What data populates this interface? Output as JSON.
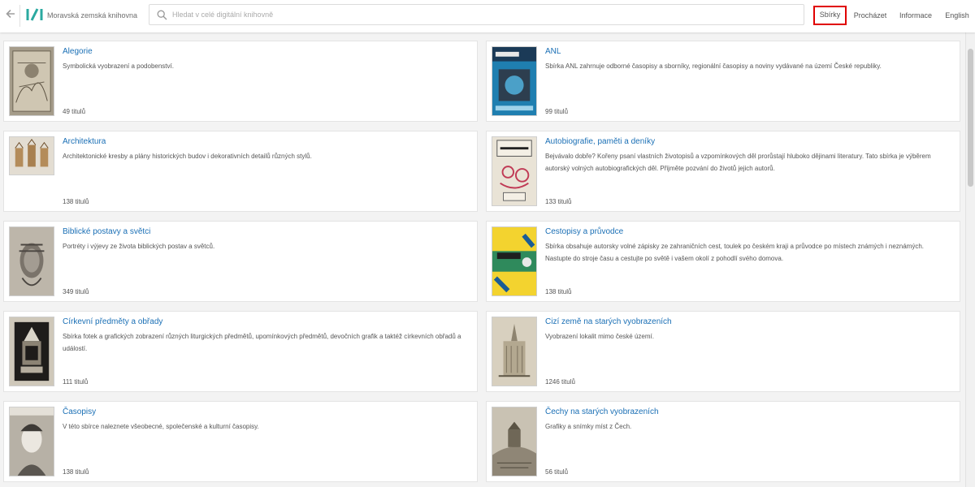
{
  "header": {
    "back_icon": "arrow-left-icon",
    "library_name": "Moravská zemská knihovna",
    "search": {
      "placeholder": "Hledat v celé digitální knihovně",
      "value": ""
    },
    "nav": [
      {
        "label": "Sbírky",
        "active": true
      },
      {
        "label": "Procházet",
        "active": false
      },
      {
        "label": "Informace",
        "active": false
      },
      {
        "label": "English",
        "active": false
      }
    ],
    "accent_color": "#e00000"
  },
  "collections": [
    {
      "title": "Alegorie",
      "description": "Symbolická vyobrazení a podobenství.",
      "count": "49 titulů",
      "thumb": "engraving-allegory"
    },
    {
      "title": "ANL",
      "description": "Sbírka ANL zahrnuje odborné časopisy a sborníky, regionální časopisy a noviny vydávané na území České republiky.",
      "count": "99 titulů",
      "thumb": "magazine-cover-artterapie"
    },
    {
      "title": "Architektura",
      "description": "Architektonické kresby a plány historických budov i dekorativních detailů různých stylů.",
      "count": "138 titulů",
      "thumb": "architecture-drawing"
    },
    {
      "title": "Autobiografie, paměti a deníky",
      "description": "Bejvávalo dobře? Kořeny psaní vlastních životopisů a vzpomínkových děl prorůstají hluboko dějinami literatury. Tato sbírka je výběrem autorský volných autobiografických děl. Přijměte pozvání do životů jejich autorů.",
      "count": "133 titulů",
      "thumb": "book-cover-z-mych-pameti"
    },
    {
      "title": "Biblické postavy a světci",
      "description": "Portréty i výjevy ze života biblických postav a světců.",
      "count": "349 titulů",
      "thumb": "engraving-portrait"
    },
    {
      "title": "Cestopisy a průvodce",
      "description": "Sbírka obsahuje autorsky volné zápisky ze zahraničních cest, toulek po českém kraji a průvodce po místech známých i neznámých. Nastupte do stroje času a cestujte po světě i vašem okolí z pohodlí svého domova.",
      "count": "138 titulů",
      "thumb": "book-cover-capek"
    },
    {
      "title": "Církevní předměty a obřady",
      "description": "Sbírka fotek a grafických zobrazení různých liturgických předmětů, upomínkových předmětů, devočních grafik a taktéž církevních obřadů a událostí.",
      "count": "111 titulů",
      "thumb": "altar-photo"
    },
    {
      "title": "Cizí země na starých vyobrazeních",
      "description": "Vyobrazení lokalit mimo české území.",
      "count": "1246 titulů",
      "thumb": "cathedral-engraving"
    },
    {
      "title": "Časopisy",
      "description": "V této sbírce naleznete všeobecné, společenské a kulturní časopisy.",
      "count": "138 titulů",
      "thumb": "magazine-portrait-cover"
    },
    {
      "title": "Čechy na starých vyobrazeních",
      "description": "Grafiky a snímky míst z Čech.",
      "count": "56 titulů",
      "thumb": "castle-engraving"
    }
  ]
}
